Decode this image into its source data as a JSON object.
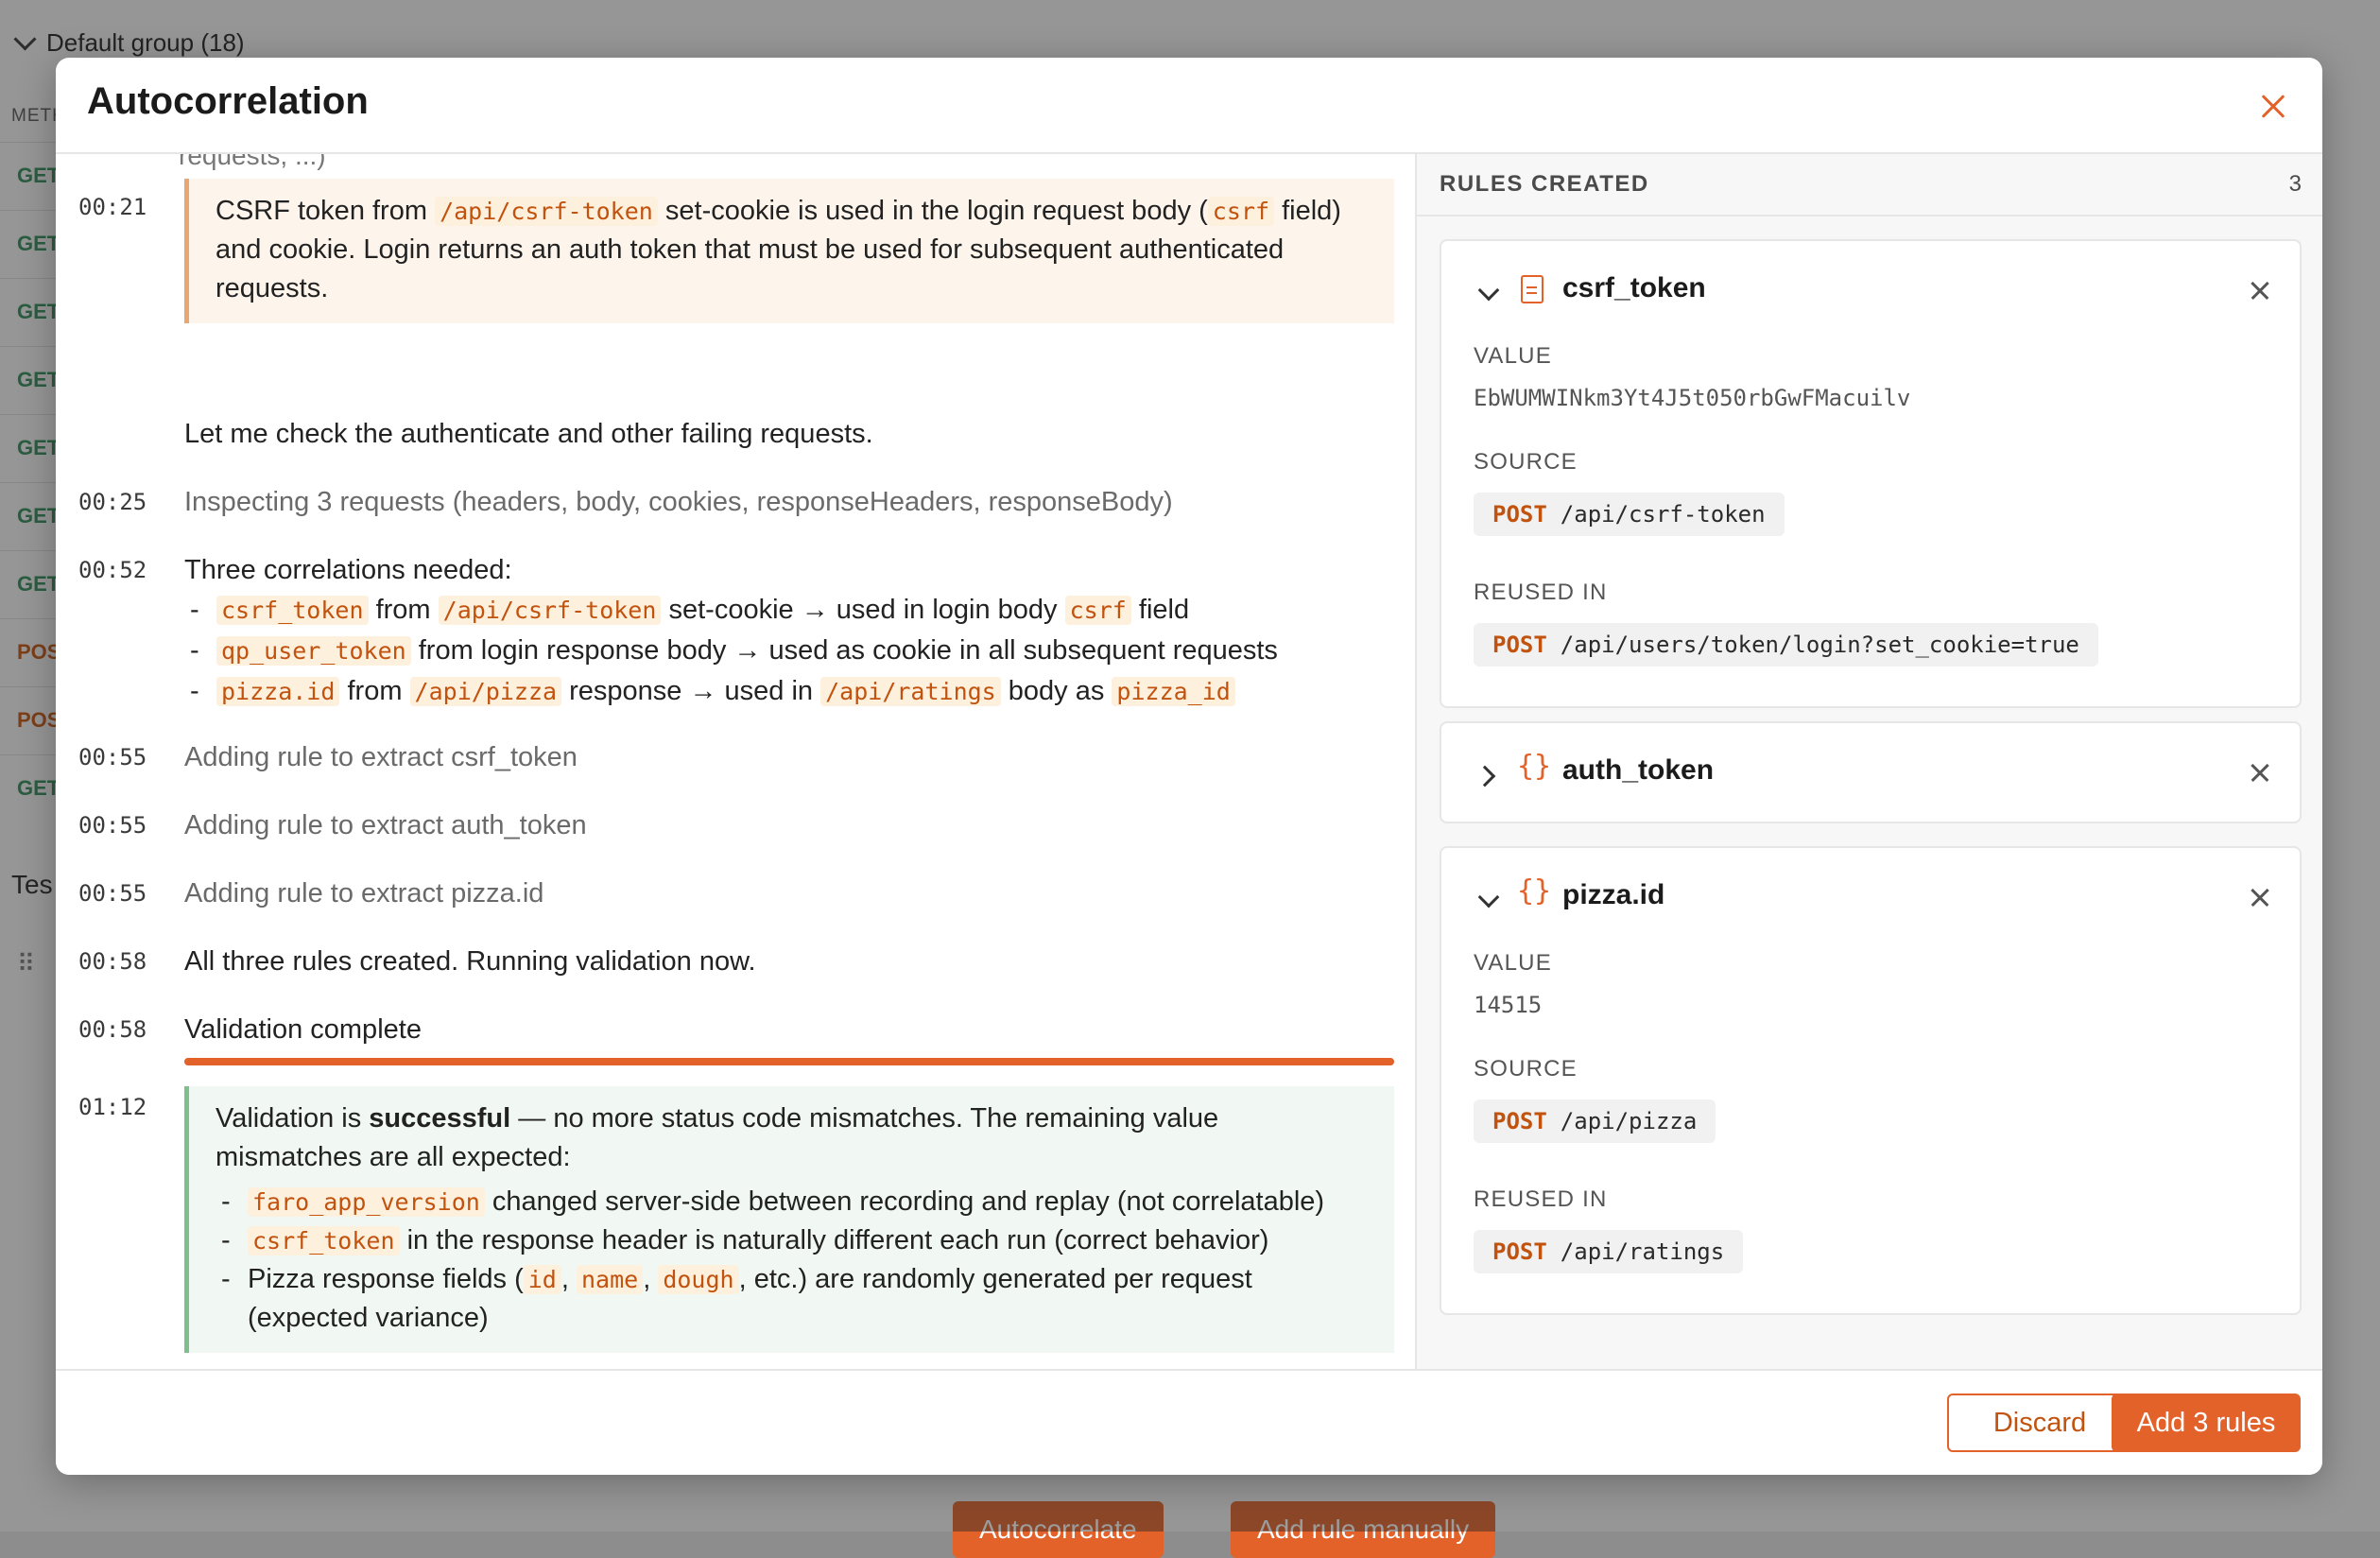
{
  "background": {
    "group_label": "Default group (18)",
    "method_header": "METHOD",
    "row_methods": [
      "GET",
      "GET",
      "GET",
      "GET",
      "GET",
      "GET",
      "GET",
      "POST",
      "POST",
      "GET"
    ],
    "test_label": "Tes",
    "grip": "⠿",
    "autocorrelate_label": "Autocorrelate",
    "add_rule_label": "Add rule manually"
  },
  "modal": {
    "title": "Autocorrelation",
    "cut_text": "requests, ...)"
  },
  "log": {
    "e1": {
      "ts": "00:21",
      "p1": "CSRF token from ",
      "c1": "/api/csrf-token",
      "p2": " set-cookie is used in the login request body (",
      "c2": "csrf",
      "p3": " field) and cookie. Login returns an auth token that must be used for subsequent authenticated requests."
    },
    "e1b": {
      "text": "Let me check the authenticate and other failing requests."
    },
    "e2": {
      "ts": "00:25",
      "text": "Inspecting 3 requests (headers, body, cookies, responseHeaders, responseBody)"
    },
    "e3": {
      "ts": "00:52",
      "intro": "Three correlations needed:",
      "b1": {
        "c1": "csrf_token",
        "t1": " from ",
        "c2": "/api/csrf-token",
        "t2": " set-cookie → used in login body ",
        "c3": "csrf",
        "t3": " field"
      },
      "b2": {
        "c1": "qp_user_token",
        "t1": " from login response body → used as cookie in all subsequent requests"
      },
      "b3": {
        "c1": "pizza.id",
        "t1": " from ",
        "c2": "/api/pizza",
        "t2": " response → used in ",
        "c3": "/api/ratings",
        "t3": " body as ",
        "c4": "pizza_id"
      }
    },
    "e4": {
      "ts": "00:55",
      "text": "Adding rule to extract csrf_token"
    },
    "e5": {
      "ts": "00:55",
      "text": "Adding rule to extract auth_token"
    },
    "e6": {
      "ts": "00:55",
      "text": "Adding rule to extract pizza.id"
    },
    "e7": {
      "ts": "00:58",
      "text": "All three rules created. Running validation now."
    },
    "e8": {
      "ts": "00:58",
      "text": "Validation complete",
      "progress": 1.0
    },
    "e9": {
      "ts": "01:12",
      "p1": "Validation is ",
      "bold": "successful",
      "p2": " — no more status code mismatches. The remaining value mismatches are all expected:",
      "b1": {
        "c1": "faro_app_version",
        "t1": " changed server-side between recording and replay (not correlatable)"
      },
      "b2": {
        "c1": "csrf_token",
        "t1": " in the response header is naturally different each run (correct behavior)"
      },
      "b3": {
        "t0": "Pizza response fields (",
        "c1": "id",
        "s1": ", ",
        "c2": "name",
        "s2": ", ",
        "c3": "dough",
        "t1": ", etc.) are randomly generated per request (expected variance)"
      }
    }
  },
  "rules": {
    "title": "RULES CREATED",
    "count": "3",
    "labels": {
      "value": "VALUE",
      "source": "SOURCE",
      "reused": "REUSED IN"
    },
    "r1": {
      "name": "csrf_token",
      "icon": "document-icon",
      "value": "EbWUMWINkm3Yt4J5t050rbGwFMacuilv",
      "source_method": "POST",
      "source_path": "/api/csrf-token",
      "reused_method": "POST",
      "reused_path": "/api/users/token/login?set_cookie=true"
    },
    "r2": {
      "name": "auth_token",
      "icon": "braces-icon"
    },
    "r3": {
      "name": "pizza.id",
      "icon": "braces-icon",
      "value": "14515",
      "source_method": "POST",
      "source_path": "/api/pizza",
      "reused_method": "POST",
      "reused_path": "/api/ratings"
    }
  },
  "footer": {
    "discard": "Discard",
    "add": "Add 3 rules"
  },
  "colors": {
    "accent": "#e2622a",
    "code_text": "#c2530f",
    "success_border": "#7fbf8c"
  }
}
